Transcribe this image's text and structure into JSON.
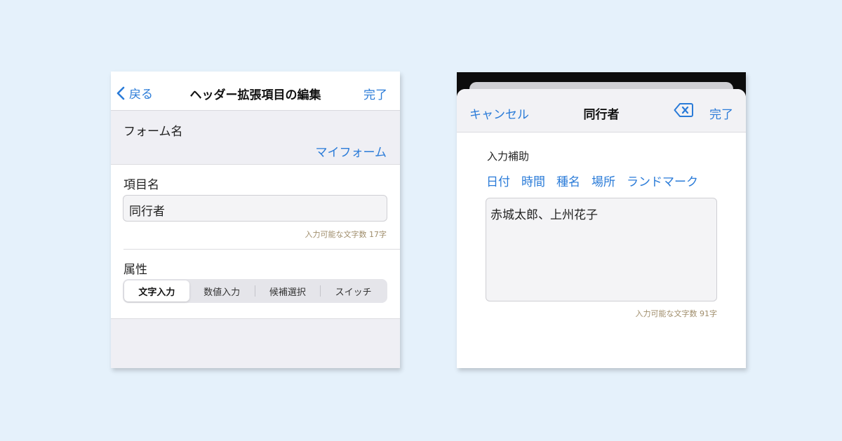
{
  "left": {
    "nav": {
      "back_label": "戻る",
      "title": "ヘッダー拡張項目の編集",
      "done_label": "完了"
    },
    "form_name": {
      "label": "フォーム名",
      "value": "マイフォーム"
    },
    "item_name": {
      "label": "項目名",
      "value": "同行者",
      "char_count": "入力可能な文字数 17字"
    },
    "attribute": {
      "label": "属性",
      "segments": [
        "文字入力",
        "数値入力",
        "候補選択",
        "スイッチ"
      ],
      "selected": "文字入力"
    }
  },
  "right": {
    "nav": {
      "cancel_label": "キャンセル",
      "title": "同行者",
      "clear_icon": "delete-left-icon",
      "done_label": "完了"
    },
    "assist": {
      "label": "入力補助",
      "options": [
        "日付",
        "時間",
        "種名",
        "場所",
        "ランドマーク"
      ]
    },
    "text": {
      "value": "赤城太郎、上州花子",
      "char_count": "入力可能な文字数 91字"
    }
  },
  "colors": {
    "accent": "#2a7bd8",
    "background": "#e5f1fb",
    "count_text": "#a08e6c"
  }
}
